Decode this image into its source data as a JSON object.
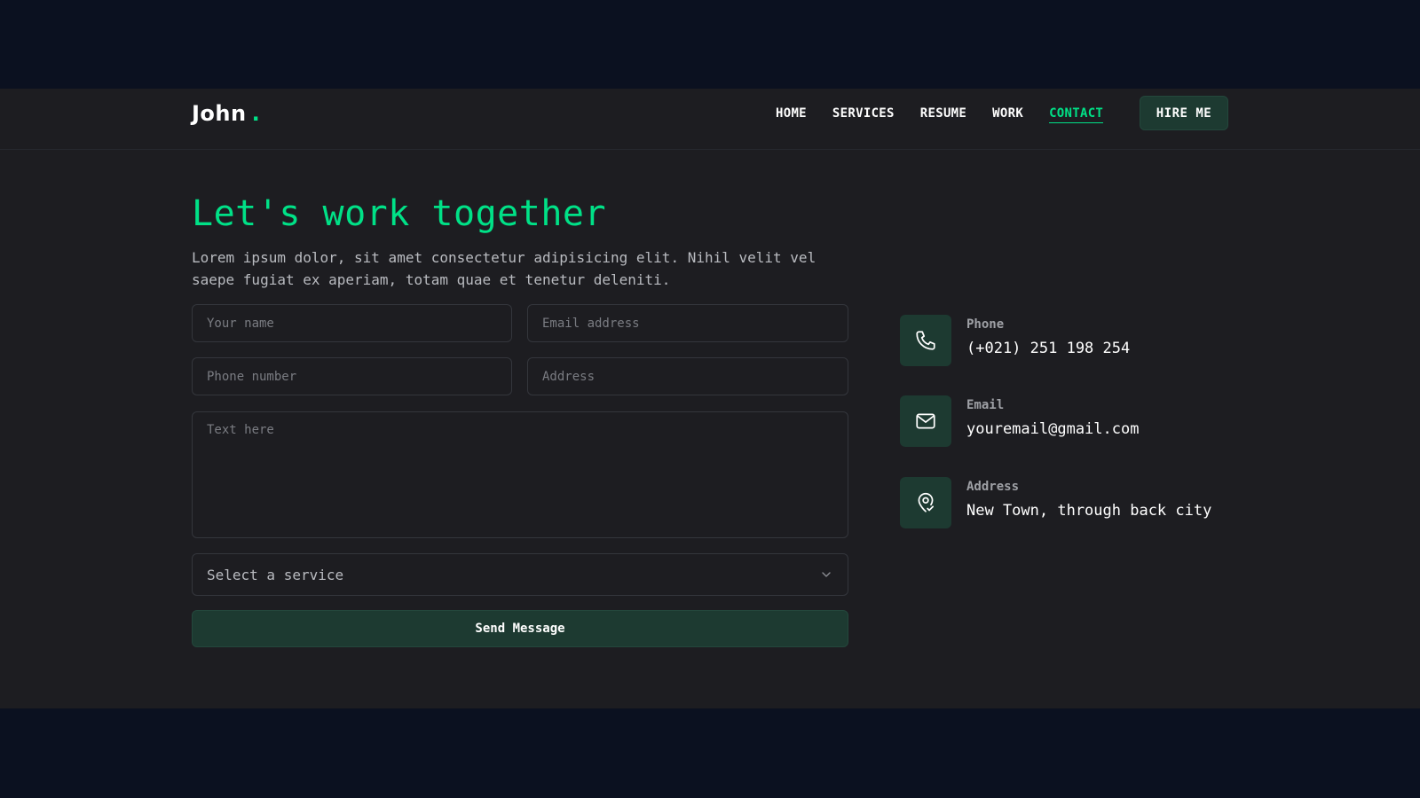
{
  "brand": {
    "name": "John",
    "dot": "."
  },
  "nav": {
    "items": [
      {
        "label": "HOME"
      },
      {
        "label": "SERVICES"
      },
      {
        "label": "RESUME"
      },
      {
        "label": "WORK"
      },
      {
        "label": "CONTACT",
        "active": true
      }
    ],
    "hire_label": "HIRE ME"
  },
  "hero": {
    "title": "Let's work together",
    "lead": "Lorem ipsum dolor, sit amet consectetur adipisicing elit. Nihil velit vel saepe fugiat ex aperiam, totam quae et tenetur deleniti."
  },
  "form": {
    "name_placeholder": "Your name",
    "email_placeholder": "Email address",
    "phone_placeholder": "Phone number",
    "address_placeholder": "Address",
    "message_placeholder": "Text here",
    "service_select": {
      "selected": "Select a service",
      "icon": "chevron-down-icon"
    },
    "submit_label": "Send Message"
  },
  "contact_info": [
    {
      "icon": "phone-icon",
      "label": "Phone",
      "value": "(+021) 251 198 254"
    },
    {
      "icon": "mail-icon",
      "label": "Email",
      "value": "youremail@gmail.com"
    },
    {
      "icon": "map-pin-icon",
      "label": "Address",
      "value": "New Town, through back city"
    }
  ],
  "colors": {
    "accent": "#00e187",
    "page_bg": "#1d1d21",
    "outer_bg": "#0b1120",
    "button_bg": "#1d3a31"
  }
}
